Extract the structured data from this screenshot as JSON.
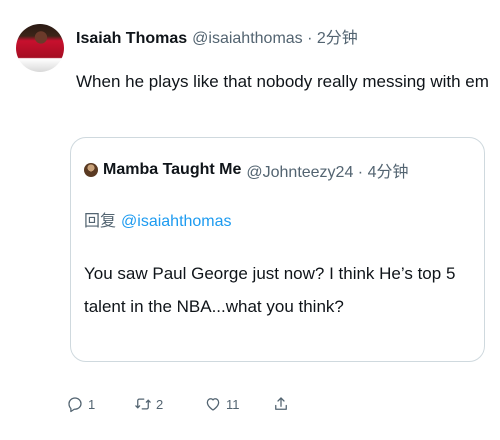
{
  "tweet": {
    "author_name": "Isaiah Thomas",
    "author_handle": "@isaiahthomas · 2分钟",
    "text": "When he plays like that nobody really messing with em"
  },
  "quoted_tweet": {
    "author_name": "Mamba Taught Me",
    "author_handle": "@Johnteezy24 · 4分钟",
    "reply_prefix": "回复",
    "reply_mention": "@isaiahthomas",
    "text": "You saw Paul George just now? I think He’s top 5 talent in the NBA...what you think?"
  },
  "actions": {
    "reply_count": "1",
    "retweet_count": "2",
    "like_count": "11"
  },
  "icons": [
    "reply-icon",
    "retweet-icon",
    "like-icon",
    "share-icon"
  ],
  "colors": {
    "text": "#0f1419",
    "secondary": "#536471",
    "link": "#1d9bf0",
    "border": "#cfd9de"
  }
}
